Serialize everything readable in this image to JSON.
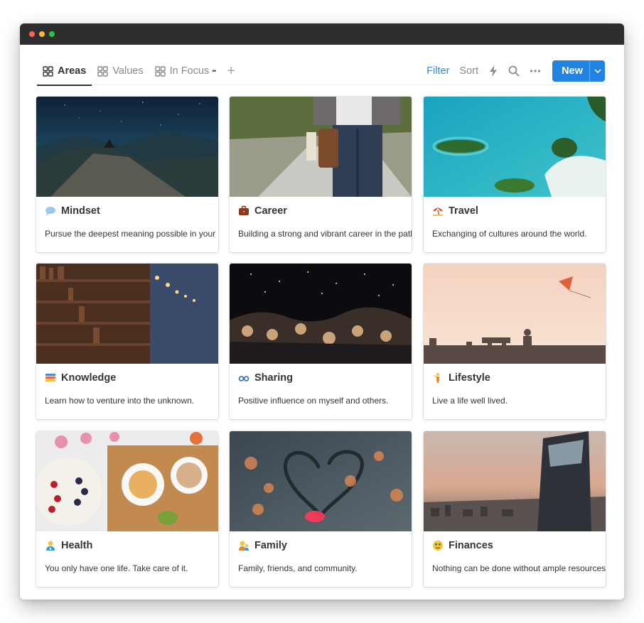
{
  "tabs": [
    {
      "label": "Areas",
      "active": true
    },
    {
      "label": "Values",
      "active": false
    },
    {
      "label": "In Focus",
      "active": false,
      "badge": "••"
    }
  ],
  "actions": {
    "filter": "Filter",
    "sort": "Sort",
    "new_label": "New"
  },
  "icons": [
    "grid-icon",
    "plus-icon",
    "lightning-icon",
    "search-icon",
    "more-icon",
    "chevron-down-icon"
  ],
  "colors": {
    "accent": "#2383e2",
    "titlebar": "#2e2e2e"
  },
  "cards": [
    {
      "title": "Mindset",
      "icon": "speech-bubble-icon",
      "description": "Pursue the deepest meaning possible in your life.",
      "cover": "night-sky-mountain"
    },
    {
      "title": "Career",
      "icon": "briefcase-icon",
      "description": "Building a strong and vibrant career in the path I choose.",
      "cover": "man-with-bag-on-road"
    },
    {
      "title": "Travel",
      "icon": "beach-umbrella-icon",
      "description": "Exchanging of cultures around the world.",
      "cover": "aerial-ocean-islands"
    },
    {
      "title": "Knowledge",
      "icon": "books-icon",
      "description": "Learn how to venture into the unknown.",
      "cover": "library-shelves"
    },
    {
      "title": "Sharing",
      "icon": "glasses-icon",
      "description": "Positive influence on myself and others.",
      "cover": "concert-crowd"
    },
    {
      "title": "Lifestyle",
      "icon": "person-icon",
      "description": "Live a life well lived.",
      "cover": "kite-sunset-skyline"
    },
    {
      "title": "Health",
      "icon": "health-worker-icon",
      "description": "You only have one life. Take care of it.",
      "cover": "breakfast-table"
    },
    {
      "title": "Family",
      "icon": "family-icon",
      "description": "Family, friends, and community.",
      "cover": "heart-bokeh"
    },
    {
      "title": "Finances",
      "icon": "money-face-icon",
      "description": "Nothing can be done without ample resources.",
      "cover": "city-skyscraper"
    }
  ]
}
